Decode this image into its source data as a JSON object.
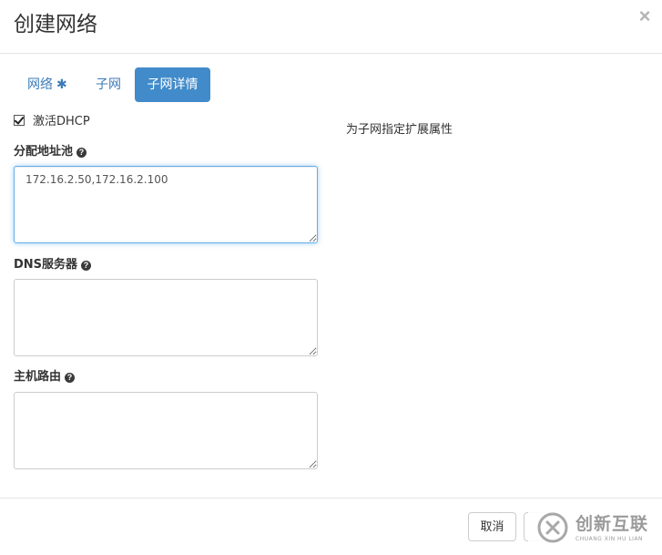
{
  "modal": {
    "title": "创建网络",
    "close_symbol": "×"
  },
  "tabs": [
    {
      "label": "网络",
      "required_marker": "✱",
      "active": false
    },
    {
      "label": "子网",
      "active": false
    },
    {
      "label": "子网详情",
      "active": true
    }
  ],
  "form": {
    "enable_dhcp": {
      "label": "激活DHCP",
      "checked": true
    },
    "allocation_pools": {
      "label": "分配地址池",
      "value": "172.16.2.50,172.16.2.100"
    },
    "dns_servers": {
      "label": "DNS服务器",
      "value": ""
    },
    "host_routes": {
      "label": "主机路由",
      "value": ""
    },
    "help_glyph": "?"
  },
  "description": "为子网指定扩展属性",
  "footer": {
    "cancel_label": "取消",
    "next_label": ""
  },
  "watermark": {
    "text": "创新互联",
    "subtext": "CHUANG XIN HU LIAN"
  },
  "colors": {
    "accent": "#428bca",
    "link": "#3c7bb8",
    "focus_border": "#66afe9"
  },
  "icons": {
    "close": "close-icon",
    "help": "question-circle-icon",
    "required": "asterisk-icon",
    "checkbox": "checkbox-checked-icon"
  }
}
